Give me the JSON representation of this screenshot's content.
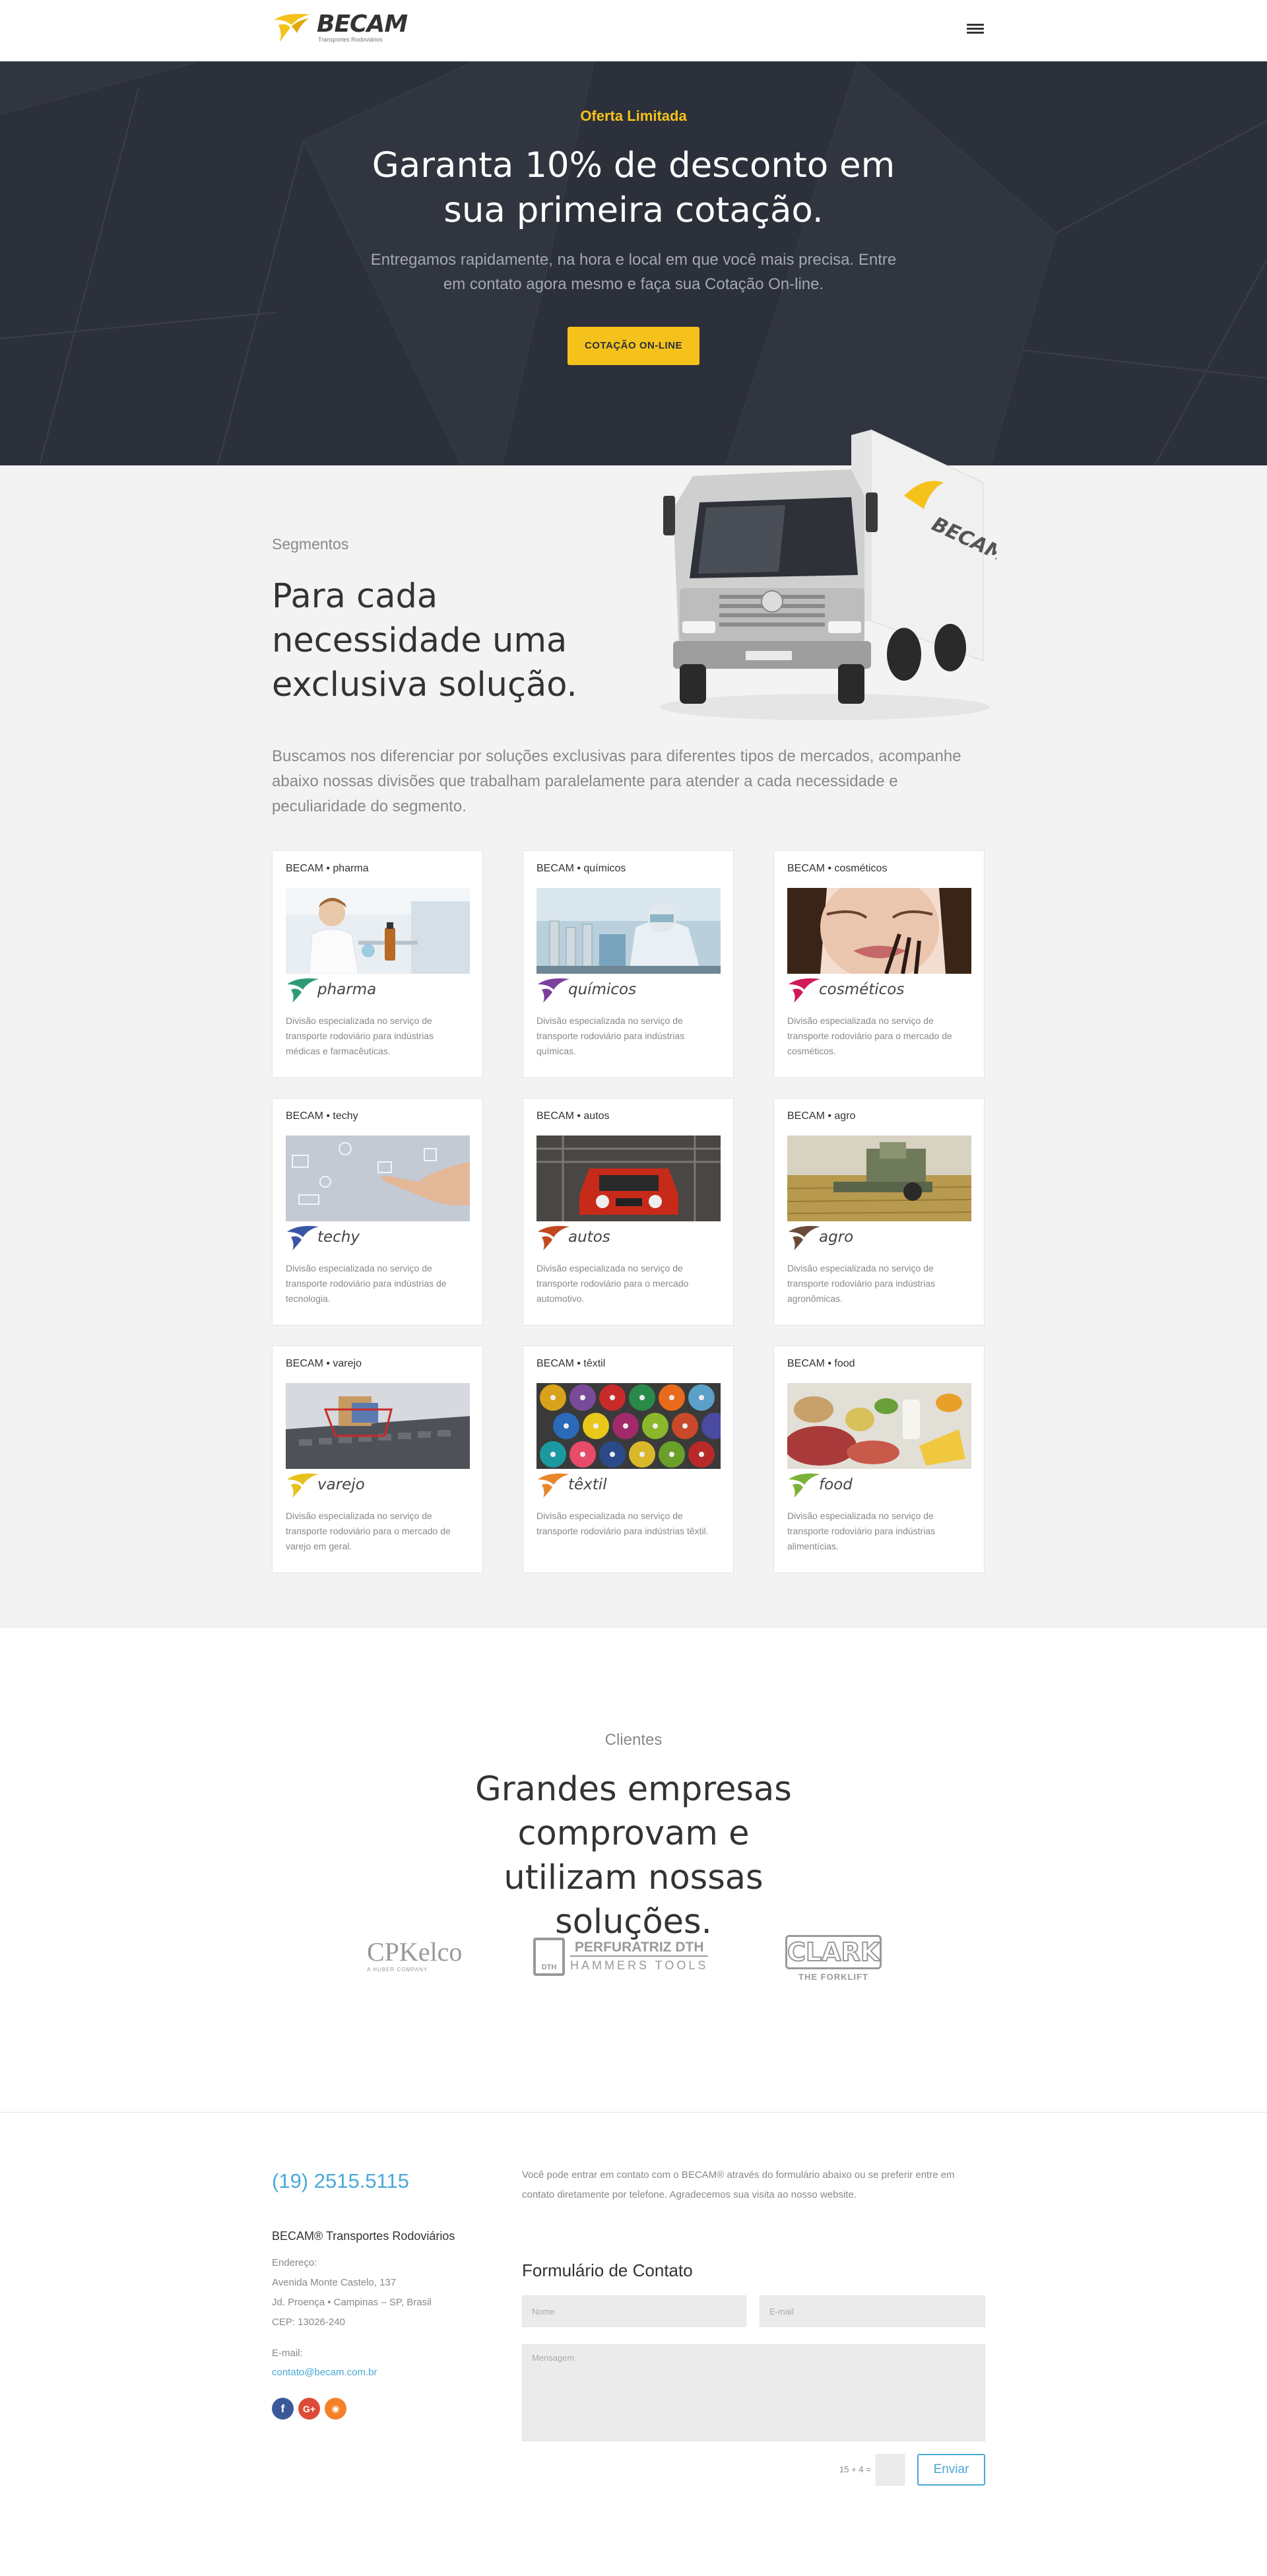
{
  "header": {
    "logo_name": "BECAM",
    "logo_tagline": "Transportes Rodoviários",
    "menu_icon": "hamburger-menu-icon"
  },
  "hero": {
    "kicker": "Oferta Limitada",
    "title": "Garanta 10% de desconto em sua primeira cotação.",
    "subtitle": "Entregamos rapidamente, na hora e local em que você mais precisa. Entre em contato agora mesmo e faça sua Cotação On-line.",
    "button": "COTAÇÃO ON-LINE"
  },
  "segments": {
    "kicker": "Segmentos",
    "title": "Para cada necessidade uma exclusiva solução.",
    "description": "Buscamos nos diferenciar por soluções exclusivas para diferentes tipos de mercados, acompanhe abaixo nossas divisões que trabalham paralelamente para atender a cada necessidade e peculiaridade do segmento.",
    "truck_brand": "BECAM",
    "cards": [
      {
        "title": "BECAM • pharma",
        "brand": "pharma",
        "color": "#2e9a7a",
        "desc": "Divisão especializada no serviço de transporte rodoviário para indústrias médicas e farmacêuticas."
      },
      {
        "title": "BECAM • químicos",
        "brand": "químicos",
        "color": "#7b3f9e",
        "desc": "Divisão especializada no serviço de transporte rodoviário para indústrias químicas."
      },
      {
        "title": "BECAM • cosméticos",
        "brand": "cosméticos",
        "color": "#d01a5a",
        "desc": "Divisão especializada no serviço de transporte rodoviário para o mercado de cosméticos."
      },
      {
        "title": "BECAM • techy",
        "brand": "techy",
        "color": "#3a55a5",
        "desc": "Divisão especializada no serviço de transporte rodoviário para indústrias de tecnologia."
      },
      {
        "title": "BECAM • autos",
        "brand": "autos",
        "color": "#c2471c",
        "desc": "Divisão especializada no serviço de transporte rodoviário para o mercado automotivo."
      },
      {
        "title": "BECAM • agro",
        "brand": "agro",
        "color": "#6b4a3a",
        "desc": "Divisão especializada no serviço de transporte rodoviário para indústrias agronômicas."
      },
      {
        "title": "BECAM • varejo",
        "brand": "varejo",
        "color": "#e8c11c",
        "desc": "Divisão especializada no serviço de transporte rodoviário para o mercado de varejo em geral."
      },
      {
        "title": "BECAM • têxtil",
        "brand": "têxtil",
        "color": "#e8862a",
        "desc": "Divisão especializada no serviço de transporte rodoviário para indústrias têxtil."
      },
      {
        "title": "BECAM • food",
        "brand": "food",
        "color": "#7ab23a",
        "desc": "Divisão especializada no serviço de transporte rodoviário para indústrias alimentícias."
      }
    ]
  },
  "clients": {
    "kicker": "Clientes",
    "title": "Grandes empresas comprovam e utilizam nossas soluções.",
    "logos": [
      {
        "name": "CPKelco",
        "sub": "A HUBER COMPANY"
      },
      {
        "name": "PERFURATRIZ DTH",
        "sub": "HAMMERS TOOLS",
        "badge": "DTH"
      },
      {
        "name": "CLARK",
        "sub": "THE FORKLIFT"
      }
    ]
  },
  "contact": {
    "phone": "(19) 2515.5115",
    "company": "BECAM® Transportes Rodoviários",
    "address_label": "Endereço:",
    "address_line1": "Avenida Monte Castelo, 137",
    "address_line2": "Jd. Proença • Campinas – SP, Brasil",
    "address_line3": "CEP: 13026-240",
    "email_label": "E-mail:",
    "email": "contato@becam.com.br",
    "intro": "Você pode entrar em contato com o BECAM® através do formulário abaixo ou se preferir entre em contato diretamente por telefone. Agradecemos sua visita ao nosso website.",
    "form_title": "Formulário de Contato",
    "name_placeholder": "Nome",
    "email_placeholder": "E-mail",
    "message_placeholder": "Mensagem",
    "captcha": "15 + 4 =",
    "send": "Enviar",
    "social": [
      {
        "icon": "facebook-icon",
        "glyph": "f",
        "color": "#3b5998"
      },
      {
        "icon": "google-plus-icon",
        "glyph": "G+",
        "color": "#dd4b39"
      },
      {
        "icon": "rss-icon",
        "glyph": "◉",
        "color": "#f4812a"
      }
    ]
  }
}
